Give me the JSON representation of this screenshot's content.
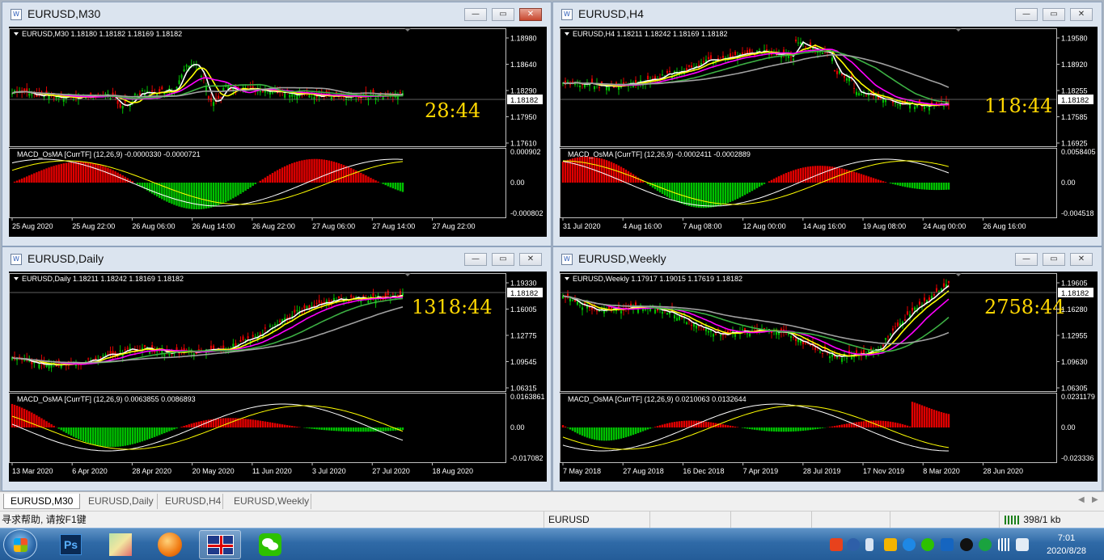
{
  "windows": [
    {
      "id": "m30",
      "title": "EURUSD,M30",
      "chart_label": "EURUSD,M30",
      "ohlc": "1.18180 1.18182 1.18169 1.18182",
      "current_price": "1.18182",
      "timer": "28:44",
      "price_axis": [
        "1.18980",
        "1.18640",
        "1.18290",
        "1.17950",
        "1.17610"
      ],
      "macd_label": "MACD_OsMA [CurrTF] (12,26,9) -0.0000330 -0.0000721",
      "macd_axis": [
        "0.000902",
        "0.00",
        "-0.000802"
      ],
      "dates": [
        "25 Aug 2020",
        "25 Aug 22:00",
        "26 Aug 06:00",
        "26 Aug 14:00",
        "26 Aug 22:00",
        "27 Aug 06:00",
        "27 Aug 14:00",
        "27 Aug 22:00"
      ]
    },
    {
      "id": "h4",
      "title": "EURUSD,H4",
      "chart_label": "EURUSD,H4",
      "ohlc": "1.18211 1.18242 1.18169 1.18182",
      "current_price": "1.18182",
      "timer": "118:44",
      "price_axis": [
        "1.19580",
        "1.18920",
        "1.18255",
        "1.17585",
        "1.16925"
      ],
      "macd_label": "MACD_OsMA [CurrTF] (12,26,9) -0.0002411 -0.0002889",
      "macd_axis": [
        "0.0058405",
        "0.00",
        "-0.004518"
      ],
      "dates": [
        "31 Jul 2020",
        "4 Aug 16:00",
        "7 Aug 08:00",
        "12 Aug 00:00",
        "14 Aug 16:00",
        "19 Aug 08:00",
        "24 Aug 00:00",
        "26 Aug 16:00"
      ]
    },
    {
      "id": "daily",
      "title": "EURUSD,Daily",
      "chart_label": "EURUSD,Daily",
      "ohlc": "1.18211 1.18242 1.18169 1.18182",
      "current_price": "1.18182",
      "timer": "1318:44",
      "price_axis": [
        "1.19330",
        "1.16005",
        "1.12775",
        "1.09545",
        "1.06315"
      ],
      "macd_label": "MACD_OsMA [CurrTF] (12,26,9) 0.0063855 0.0086893",
      "macd_axis": [
        "0.0163861",
        "0.00",
        "-0.017082"
      ],
      "dates": [
        "13 Mar 2020",
        "6 Apr 2020",
        "28 Apr 2020",
        "20 May 2020",
        "11 Jun 2020",
        "3 Jul 2020",
        "27 Jul 2020",
        "18 Aug 2020"
      ]
    },
    {
      "id": "weekly",
      "title": "EURUSD,Weekly",
      "chart_label": "EURUSD,Weekly",
      "ohlc": "1.17917 1.19015 1.17619 1.18182",
      "current_price": "1.18182",
      "timer": "2758:44",
      "price_axis": [
        "1.19605",
        "1.16280",
        "1.12955",
        "1.09630",
        "1.06305"
      ],
      "macd_label": "MACD_OsMA [CurrTF] (12,26,9) 0.0210063 0.0132644",
      "macd_axis": [
        "0.0231179",
        "0.00",
        "-0.023336"
      ],
      "dates": [
        "7 May 2018",
        "27 Aug 2018",
        "16 Dec 2018",
        "7 Apr 2019",
        "28 Jul 2019",
        "17 Nov 2019",
        "8 Mar 2020",
        "28 Jun 2020"
      ]
    }
  ],
  "tabs": [
    "EURUSD,M30",
    "EURUSD,Daily",
    "EURUSD,H4",
    "EURUSD,Weekly"
  ],
  "active_tab": "EURUSD,M30",
  "status": {
    "help": "寻求帮助, 请按F1键",
    "symbol": "EURUSD",
    "traffic": "398/1 kb"
  },
  "clock": {
    "time": "7:01",
    "date": "2020/8/28"
  },
  "colors": {
    "chart_bg": "#000000",
    "bull": "#00c000",
    "bear": "#e00000",
    "ma_white": "#ffffff",
    "ma_yellow": "#ffff00",
    "ma_magenta": "#ff00ff",
    "ma_green": "#3cb043",
    "ma_gray": "#a0a0a0",
    "timer": "#ffd700",
    "axis_text": "#ffffff"
  }
}
